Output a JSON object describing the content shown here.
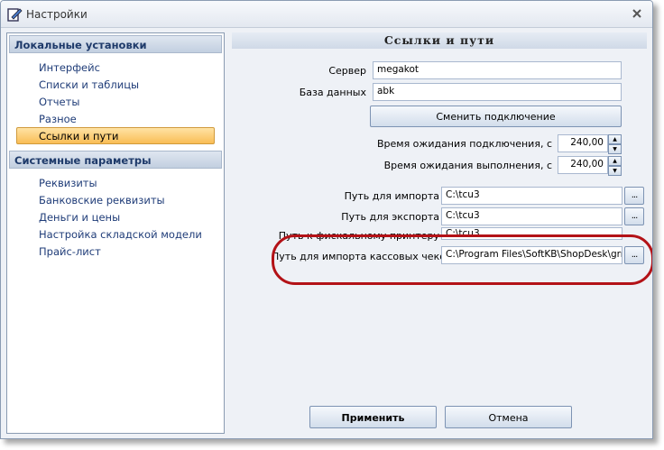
{
  "window": {
    "title": "Настройки"
  },
  "sidebar": {
    "groups": [
      {
        "label": "Локальные установки",
        "items": [
          "Интерфейс",
          "Списки и таблицы",
          "Отчеты",
          "Разное",
          "Ссылки и пути"
        ]
      },
      {
        "label": "Системные параметры",
        "items": [
          "Реквизиты",
          "Банковские реквизиты",
          "Деньги и цены",
          "Настройка складской модели",
          "Прайс-лист"
        ]
      }
    ],
    "selected": "Ссылки и пути"
  },
  "content": {
    "title": "Ссылки и пути",
    "server": {
      "label": "Сервер",
      "value": "megakot"
    },
    "database": {
      "label": "База данных",
      "value": "abk"
    },
    "change_connection_label": "Сменить подключение",
    "connect_timeout": {
      "label": "Время ожидания подключения, с",
      "value": "240,00"
    },
    "exec_timeout": {
      "label": "Время ожидания выполнения, с",
      "value": "240,00"
    },
    "paths": [
      {
        "label": "Путь для импорта",
        "value": "C:\\tcu3"
      },
      {
        "label": "Путь для экспорта",
        "value": "C:\\tcu3"
      },
      {
        "label": "Путь к фискальному принтеру",
        "value": "C:\\tcu3"
      },
      {
        "label": "Путь для импорта кассовых чеков",
        "value": "C:\\Program Files\\SoftKB\\ShopDesk\\grr"
      }
    ],
    "browse_label": "..."
  },
  "footer": {
    "apply_label": "Применить",
    "cancel_label": "Отмена"
  },
  "colors": {
    "highlight": "#b31217",
    "selected_bg": "#f9bd55",
    "nav_text": "#1f3c78"
  }
}
